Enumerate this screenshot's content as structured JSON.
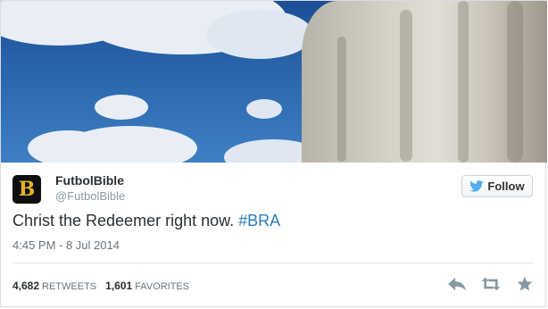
{
  "author": {
    "name": "FutbolBible",
    "handle": "@FutbolBible",
    "avatar_letter": "B"
  },
  "follow_button": {
    "label": "Follow"
  },
  "tweet": {
    "text": "Christ the Redeemer right now. ",
    "hashtag": "#BRA",
    "timestamp": "4:45 PM - 8 Jul 2014"
  },
  "stats": {
    "retweets_count": "4,682",
    "retweets_label": "RETWEETS",
    "favorites_count": "1,601",
    "favorites_label": "FAVORITES"
  },
  "actions": {
    "reply_icon": "reply-icon",
    "retweet_icon": "retweet-icon",
    "favorite_icon": "star-icon"
  },
  "colors": {
    "hashtag": "#2b7bb9",
    "muted": "#8899a6",
    "text": "#292f33"
  }
}
